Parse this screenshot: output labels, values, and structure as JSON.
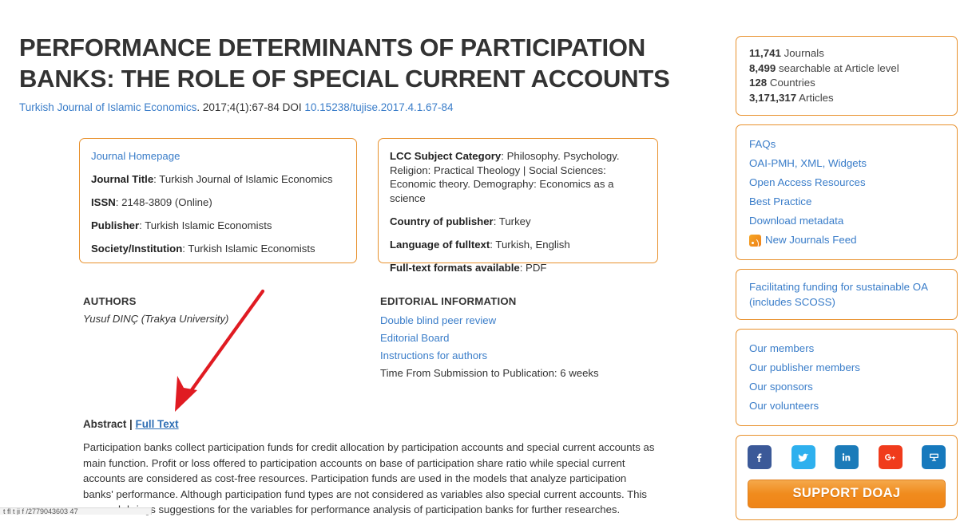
{
  "article": {
    "title": "PERFORMANCE DETERMINANTS OF PARTICIPATION BANKS: THE ROLE OF SPECIAL CURRENT ACCOUNTS",
    "journal_link": "Turkish Journal of Islamic Economics",
    "citation_middle": ". 2017;4(1):67-84 DOI ",
    "doi_link": "10.15238/tujise.2017.4.1.67-84"
  },
  "journal_box": {
    "homepage_link": "Journal Homepage",
    "rows": [
      {
        "label": "Journal Title",
        "value": "Turkish Journal of Islamic Economics"
      },
      {
        "label": "ISSN",
        "value": "2148-3809 (Online)"
      },
      {
        "label": "Publisher",
        "value": "Turkish Islamic Economists"
      },
      {
        "label": "Society/Institution",
        "value": "Turkish Islamic Economists"
      }
    ]
  },
  "subject_box": {
    "rows": [
      {
        "label": "LCC Subject Category",
        "value": "Philosophy. Psychology. Religion: Practical Theology | Social Sciences: Economic theory. Demography: Economics as a science"
      },
      {
        "label": "Country of publisher",
        "value": "Turkey"
      },
      {
        "label": "Language of fulltext",
        "value": "Turkish, English"
      },
      {
        "label": "Full-text formats available",
        "value": "PDF"
      }
    ]
  },
  "authors": {
    "heading": "AUTHORS",
    "name": "Yusuf DINÇ (Trakya University)"
  },
  "editorial": {
    "heading": "EDITORIAL INFORMATION",
    "links": [
      "Double blind peer review",
      "Editorial Board",
      "Instructions for authors"
    ],
    "time_line": "Time From Submission to Publication: 6 weeks"
  },
  "abstract": {
    "label": "Abstract",
    "separator": " | ",
    "fulltext_link": "Full Text",
    "body": "Participation banks collect participation funds for credit allocation by participation accounts and special current accounts as main function. Profit or loss offered to participation accounts on base of participation share ratio while special current accounts are considered as cost-free resources. Participation funds are used in the models that analyze participation banks' performance. Although participation fund types are not considered as variables also special current accounts. This research brings suggestions for the variables for performance analysis of participation banks for further researches."
  },
  "sidebar": {
    "stats": [
      {
        "number": "11,741",
        "label": " Journals"
      },
      {
        "number": "8,499",
        "label": " searchable at Article level"
      },
      {
        "number": "128",
        "label": " Countries"
      },
      {
        "number": "3,171,317",
        "label": " Articles"
      }
    ],
    "resource_links": [
      "FAQs",
      "OAI-PMH, XML, Widgets",
      "Open Access Resources",
      "Best Practice",
      "Download metadata"
    ],
    "feed_link": "New Journals Feed",
    "funding_link": "Facilitating funding for sustainable OA (includes SCOSS)",
    "community_links": [
      "Our members",
      "Our publisher members",
      "Our sponsors",
      "Our volunteers"
    ],
    "social": [
      {
        "name": "facebook-icon",
        "glyph": "f",
        "color": "#3b5998"
      },
      {
        "name": "twitter-icon",
        "glyph": "t",
        "color": "#2eb0ee"
      },
      {
        "name": "linkedin-icon",
        "glyph": "in",
        "color": "#1b7bb9"
      },
      {
        "name": "google-plus-icon",
        "glyph": "g+",
        "color": "#f03b1c"
      },
      {
        "name": "mendeley-icon",
        "glyph": "m",
        "color": "#1679bd"
      }
    ],
    "support_button": "SUPPORT DOAJ"
  },
  "annotation": {
    "arrow_color": "#e01b22",
    "target": "full-text-link"
  },
  "bottom_strip": {
    "text": "t fl t ji f /2779043603 47"
  }
}
